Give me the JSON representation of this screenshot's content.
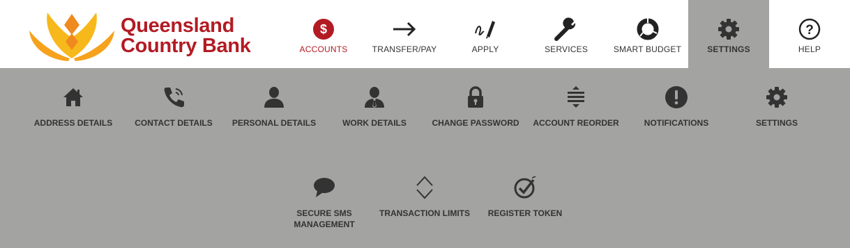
{
  "brand": {
    "line1": "Queensland",
    "line2": "Country Bank"
  },
  "nav": [
    {
      "label": "ACCOUNTS",
      "icon": "dollar-icon"
    },
    {
      "label": "TRANSFER/PAY",
      "icon": "arrow-right-icon"
    },
    {
      "label": "APPLY",
      "icon": "signature-pen-icon"
    },
    {
      "label": "SERVICES",
      "icon": "wrench-icon"
    },
    {
      "label": "SMART BUDGET",
      "icon": "donut-chart-icon"
    },
    {
      "label": "SETTINGS",
      "icon": "gear-icon"
    },
    {
      "label": "HELP",
      "icon": "question-circle-icon"
    }
  ],
  "active_nav": "ACCOUNTS",
  "expanded_nav": "SETTINGS",
  "submenu": {
    "row1": [
      {
        "label": "ADDRESS DETAILS",
        "icon": "home-icon"
      },
      {
        "label": "CONTACT DETAILS",
        "icon": "phone-icon"
      },
      {
        "label": "PERSONAL DETAILS",
        "icon": "user-icon"
      },
      {
        "label": "WORK DETAILS",
        "icon": "user-tie-icon"
      },
      {
        "label": "CHANGE PASSWORD",
        "icon": "lock-icon"
      },
      {
        "label": "ACCOUNT REORDER",
        "icon": "reorder-icon"
      },
      {
        "label": "NOTIFICATIONS",
        "icon": "exclamation-circle-icon"
      },
      {
        "label": "SETTINGS",
        "icon": "gear-icon"
      }
    ],
    "row2": [
      {
        "label": "SECURE SMS MANAGEMENT",
        "icon": "speech-bubble-icon"
      },
      {
        "label": "TRANSACTION LIMITS",
        "icon": "chevrons-up-down-icon"
      },
      {
        "label": "REGISTER TOKEN",
        "icon": "check-circle-token-icon"
      }
    ]
  },
  "colors": {
    "brand_red": "#b31b23",
    "menu_grey": "#a3a3a1",
    "logo_yellow": "#f7b81b",
    "logo_orange": "#ef8a1e",
    "icon_dark": "#333333"
  }
}
